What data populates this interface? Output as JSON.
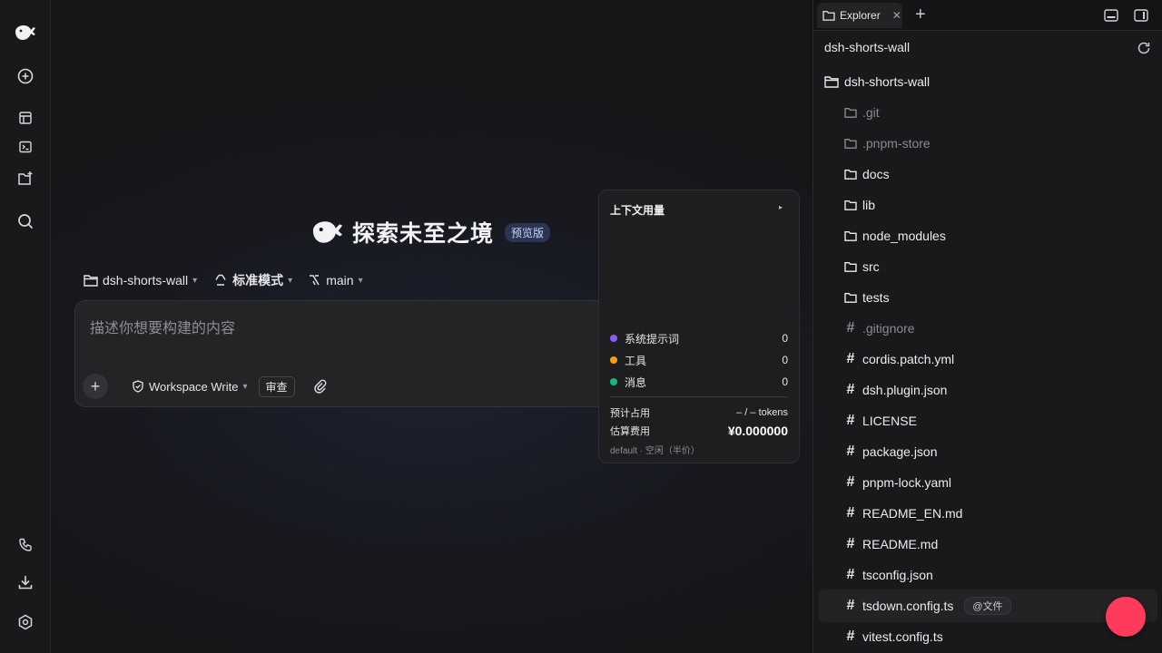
{
  "hero": {
    "title": "探索未至之境",
    "badge": "预览版"
  },
  "context_bar": {
    "project": "dsh-shorts-wall",
    "mode": "标准模式",
    "branch": "main"
  },
  "composer": {
    "placeholder": "描述你想要构建的内容",
    "permission": "Workspace Write",
    "review": "审查"
  },
  "context_panel": {
    "title": "上下文用量",
    "rows": [
      {
        "label": "系统提示词",
        "value": "0",
        "color": "#8b5cf6"
      },
      {
        "label": "工具",
        "value": "0",
        "color": "#f59e0b"
      },
      {
        "label": "消息",
        "value": "0",
        "color": "#10b981"
      }
    ],
    "estimate_label": "预计占用",
    "estimate_value": "– / – tokens",
    "cost_label": "估算费用",
    "cost_value": "¥0.000000",
    "footer": "default · 空闲（半价）"
  },
  "explorer": {
    "tab_label": "Explorer",
    "header": "dsh-shorts-wall",
    "root": "dsh-shorts-wall",
    "items": [
      {
        "name": ".git",
        "type": "folder",
        "dim": true
      },
      {
        "name": ".pnpm-store",
        "type": "folder",
        "dim": true
      },
      {
        "name": "docs",
        "type": "folder",
        "dim": false
      },
      {
        "name": "lib",
        "type": "folder",
        "dim": false
      },
      {
        "name": "node_modules",
        "type": "folder",
        "dim": false
      },
      {
        "name": "src",
        "type": "folder",
        "dim": false
      },
      {
        "name": "tests",
        "type": "folder",
        "dim": false
      },
      {
        "name": ".gitignore",
        "type": "file",
        "dim": true
      },
      {
        "name": "cordis.patch.yml",
        "type": "file",
        "dim": false
      },
      {
        "name": "dsh.plugin.json",
        "type": "file",
        "dim": false
      },
      {
        "name": "LICENSE",
        "type": "file",
        "dim": false
      },
      {
        "name": "package.json",
        "type": "file",
        "dim": false
      },
      {
        "name": "pnpm-lock.yaml",
        "type": "file",
        "dim": false
      },
      {
        "name": "README_EN.md",
        "type": "file",
        "dim": false
      },
      {
        "name": "README.md",
        "type": "file",
        "dim": false
      },
      {
        "name": "tsconfig.json",
        "type": "file",
        "dim": false
      },
      {
        "name": "tsdown.config.ts",
        "type": "file",
        "dim": false,
        "selected": true,
        "mention": "@文件"
      },
      {
        "name": "vitest.config.ts",
        "type": "file",
        "dim": false
      }
    ]
  },
  "colors": {
    "accent": "#ff3b5c",
    "badge_bg": "#2b3552"
  }
}
